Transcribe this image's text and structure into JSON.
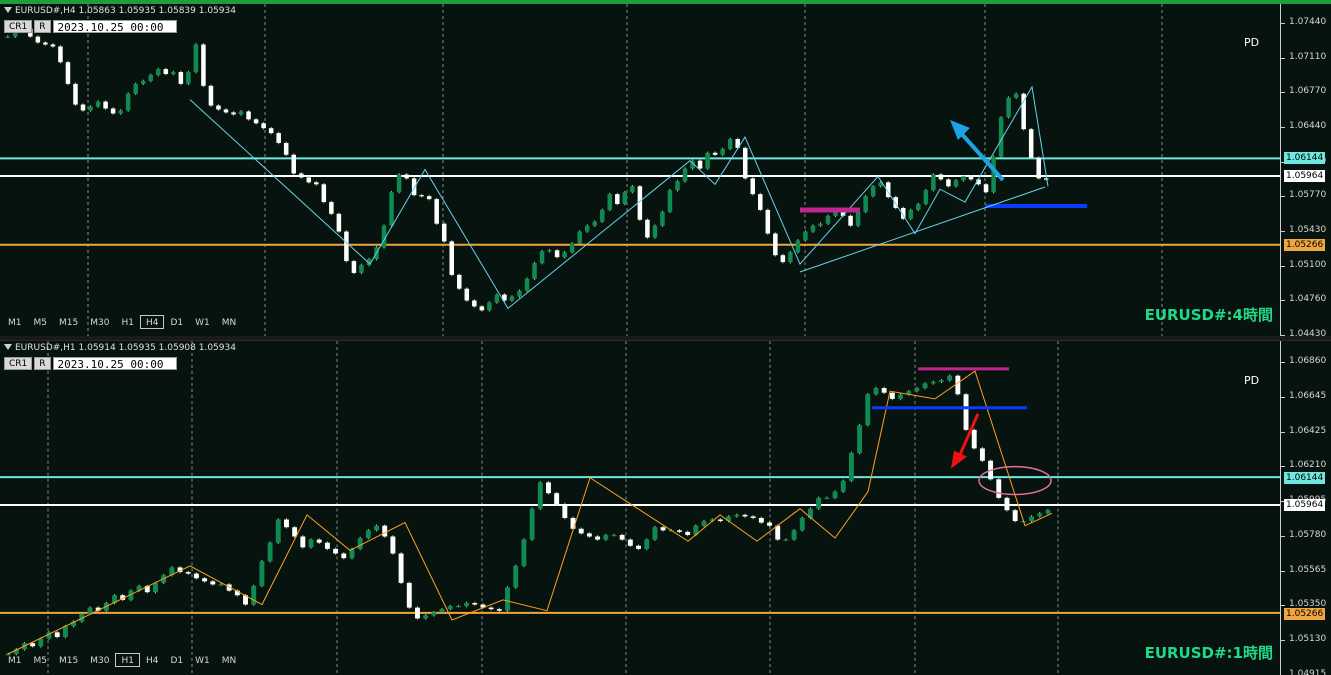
{
  "colors": {
    "background": "#07130f",
    "bull": "#0f8a52",
    "bear": "#ffffff",
    "wick": "#9bdc5a",
    "cyan_level": "#6ee7e0",
    "white_level": "#ffffff",
    "orange_level": "#f0a640",
    "zigzag_h4": "#69d2e7",
    "zigzag_h1": "#ffa020",
    "magenta": "#c0268e",
    "blue": "#0a3cff",
    "arrow_up": "#1ea2e6",
    "arrow_down": "#ee1111",
    "ellipse": "#e0709a"
  },
  "panels": [
    {
      "id": "h4",
      "info": "EURUSD#,H4  1.05863 1.05935 1.05839 1.05934",
      "buttons": [
        "CR1",
        "R"
      ],
      "date": "2023.10.25 00:00",
      "pd_label": "PD",
      "pair_label": "EURUSD#:4時間",
      "timeframes": [
        "M1",
        "M5",
        "M15",
        "M30",
        "H1",
        "H4",
        "D1",
        "W1",
        "MN"
      ],
      "active_timeframe": "H4",
      "price_ticks": [
        "1.07440",
        "1.07110",
        "1.06770",
        "1.06440",
        "1.06100",
        "1.05770",
        "1.05430",
        "1.05100",
        "1.04760",
        "1.04430"
      ],
      "price_tags": [
        {
          "label": "1.06144",
          "kind": "cyan"
        },
        {
          "label": "1.05964",
          "kind": "white"
        },
        {
          "label": "1.05266",
          "kind": "orange"
        }
      ]
    },
    {
      "id": "h1",
      "info": "EURUSD#,H1  1.05914 1.05935 1.05908 1.05934",
      "buttons": [
        "CR1",
        "R"
      ],
      "date": "2023.10.25 00:00",
      "pd_label": "PD",
      "pair_label": "EURUSD#:1時間",
      "timeframes": [
        "M1",
        "M5",
        "M15",
        "M30",
        "H1",
        "H4",
        "D1",
        "W1",
        "MN"
      ],
      "active_timeframe": "H1",
      "price_ticks": [
        "1.06860",
        "1.06645",
        "1.06425",
        "1.06210",
        "1.05995",
        "1.05780",
        "1.05565",
        "1.05350",
        "1.05130",
        "1.04915"
      ],
      "price_tags": [
        {
          "label": "1.06144",
          "kind": "cyan"
        },
        {
          "label": "1.05964",
          "kind": "white"
        },
        {
          "label": "1.05266",
          "kind": "orange"
        }
      ]
    }
  ],
  "chart_data": [
    {
      "type": "candlestick",
      "title": "EURUSD#,H4",
      "ylim": [
        1.0438,
        1.0763
      ],
      "levels": [
        {
          "name": "cyan",
          "y": 1.06144
        },
        {
          "name": "white",
          "y": 1.05964
        },
        {
          "name": "orange",
          "y": 1.05266
        }
      ],
      "zigzag": [
        1.0674,
        1.0507,
        1.0603,
        1.0462,
        1.0612,
        1.0588,
        1.0636,
        1.0507,
        1.0596,
        1.0538,
        1.0583,
        1.057,
        1.0687,
        1.0586
      ],
      "close_series": [
        1.0738,
        1.0745,
        1.0746,
        1.0738,
        1.0732,
        1.073,
        1.0728,
        1.0712,
        1.069,
        1.0669,
        1.0663,
        1.0667,
        1.0672,
        1.0665,
        1.066,
        1.0663,
        1.068,
        1.069,
        1.0693,
        1.0699,
        1.0705,
        1.07,
        1.0702,
        1.069,
        1.0702,
        1.073,
        1.0688,
        1.0668,
        1.0664,
        1.0661,
        1.0659,
        1.0662,
        1.0654,
        1.065,
        1.0645,
        1.064,
        1.063,
        1.0618,
        1.0599,
        1.0595,
        1.059,
        1.0588,
        1.057,
        1.0558,
        1.054,
        1.051,
        1.0498,
        1.0506,
        1.0512,
        1.0524,
        1.0546,
        1.058,
        1.0598,
        1.0594,
        1.0577,
        1.0576,
        1.0573,
        1.0548,
        1.053,
        1.0496,
        1.0482,
        1.047,
        1.0464,
        1.046,
        1.0468,
        1.0476,
        1.047,
        1.0474,
        1.048,
        1.0492,
        1.0508,
        1.052,
        1.0521,
        1.0514,
        1.0519,
        1.0528,
        1.054,
        1.0546,
        1.055,
        1.0562,
        1.0578,
        1.0568,
        1.058,
        1.0586,
        1.0552,
        1.0534,
        1.0546,
        1.056,
        1.0582,
        1.0591,
        1.0604,
        1.0612,
        1.0604,
        1.062,
        1.0618,
        1.0624,
        1.0634,
        1.0625,
        1.0594,
        1.0578,
        1.0562,
        1.0538,
        1.0516,
        1.0509,
        1.0519,
        1.0531,
        1.054,
        1.0546,
        1.0548,
        1.0556,
        1.056,
        1.0556,
        1.0546,
        1.056,
        1.0576,
        1.0586,
        1.059,
        1.0575,
        1.0564,
        1.0553,
        1.0562,
        1.0568,
        1.0582,
        1.0598,
        1.0593,
        1.0586,
        1.0592,
        1.0596,
        1.0593,
        1.0588,
        1.058,
        1.0616,
        1.0656,
        1.0676,
        1.068,
        1.0644,
        1.0615,
        1.0594,
        1.0593
      ]
    },
    {
      "type": "candlestick",
      "title": "EURUSD#,H1",
      "ylim": [
        1.0489,
        1.0696
      ],
      "levels": [
        {
          "name": "cyan",
          "y": 1.06144
        },
        {
          "name": "white",
          "y": 1.05964
        },
        {
          "name": "orange",
          "y": 1.05266
        }
      ],
      "zigzag": [
        1.05,
        1.0557,
        1.0532,
        1.059,
        1.0567,
        1.0585,
        1.0522,
        1.0535,
        1.0528,
        1.0614,
        1.0573,
        1.059,
        1.0573,
        1.0594,
        1.0575,
        1.0605,
        1.067,
        1.0665,
        1.0683,
        1.0583,
        1.0591
      ],
      "close_series": [
        1.05,
        1.0503,
        1.0507,
        1.0505,
        1.051,
        1.0514,
        1.0511,
        1.0518,
        1.0521,
        1.0526,
        1.053,
        1.0528,
        1.0533,
        1.0538,
        1.0535,
        1.0541,
        1.0544,
        1.054,
        1.0546,
        1.0551,
        1.0556,
        1.0553,
        1.0552,
        1.0549,
        1.0547,
        1.0545,
        1.0545,
        1.0541,
        1.0538,
        1.0532,
        1.0544,
        1.056,
        1.0572,
        1.0587,
        1.0582,
        1.0576,
        1.0569,
        1.0574,
        1.0572,
        1.0568,
        1.0565,
        1.0562,
        1.0568,
        1.0575,
        1.058,
        1.0583,
        1.0576,
        1.0565,
        1.0546,
        1.053,
        1.0523,
        1.0525,
        1.0527,
        1.0529,
        1.0531,
        1.0531,
        1.0533,
        1.0532,
        1.053,
        1.0529,
        1.0528,
        1.0543,
        1.0557,
        1.0574,
        1.0594,
        1.0611,
        1.0604,
        1.0597,
        1.0588,
        1.0581,
        1.0578,
        1.0576,
        1.0574,
        1.0577,
        1.0577,
        1.0574,
        1.057,
        1.0568,
        1.0574,
        1.0582,
        1.058,
        1.058,
        1.0579,
        1.0577,
        1.0583,
        1.0586,
        1.0587,
        1.0586,
        1.0589,
        1.059,
        1.0589,
        1.0588,
        1.0585,
        1.0583,
        1.0574,
        1.0574,
        1.058,
        1.0588,
        1.0594,
        1.0601,
        1.0601,
        1.0605,
        1.0612,
        1.063,
        1.0648,
        1.0668,
        1.0672,
        1.0669,
        1.0665,
        1.0668,
        1.067,
        1.0672,
        1.0675,
        1.0676,
        1.0677,
        1.068,
        1.0668,
        1.0645,
        1.0633,
        1.0625,
        1.0613,
        1.0601,
        1.0593,
        1.0586,
        1.0586,
        1.0589,
        1.0591,
        1.0593
      ]
    }
  ]
}
